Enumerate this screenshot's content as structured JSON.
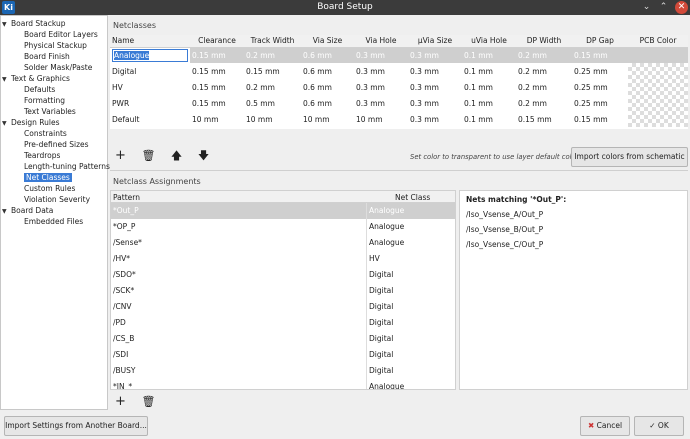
{
  "window": {
    "title": "Board Setup",
    "app_icon": "Ki"
  },
  "sidebar": {
    "items": [
      {
        "label": "Board Stackup",
        "level": 0
      },
      {
        "label": "Board Editor Layers",
        "level": 1
      },
      {
        "label": "Physical Stackup",
        "level": 1
      },
      {
        "label": "Board Finish",
        "level": 1
      },
      {
        "label": "Solder Mask/Paste",
        "level": 1
      },
      {
        "label": "Text & Graphics",
        "level": 0
      },
      {
        "label": "Defaults",
        "level": 1
      },
      {
        "label": "Formatting",
        "level": 1
      },
      {
        "label": "Text Variables",
        "level": 1
      },
      {
        "label": "Design Rules",
        "level": 0
      },
      {
        "label": "Constraints",
        "level": 1
      },
      {
        "label": "Pre-defined Sizes",
        "level": 1
      },
      {
        "label": "Teardrops",
        "level": 1
      },
      {
        "label": "Length-tuning Patterns",
        "level": 1
      },
      {
        "label": "Net Classes",
        "level": 1,
        "selected": true
      },
      {
        "label": "Custom Rules",
        "level": 1
      },
      {
        "label": "Violation Severity",
        "level": 1
      },
      {
        "label": "Board Data",
        "level": 0
      },
      {
        "label": "Embedded Files",
        "level": 1
      }
    ]
  },
  "netclasses": {
    "section_label": "Netclasses",
    "columns": [
      "Name",
      "Clearance",
      "Track Width",
      "Via Size",
      "Via Hole",
      "µVia Size",
      "uVia Hole",
      "DP Width",
      "DP Gap",
      "PCB Color"
    ],
    "rows": [
      [
        "Analogue",
        "0.15 mm",
        "0.2 mm",
        "0.6 mm",
        "0.3 mm",
        "0.3 mm",
        "0.1 mm",
        "0.2 mm",
        "0.15 mm"
      ],
      [
        "Digital",
        "0.15 mm",
        "0.15 mm",
        "0.6 mm",
        "0.3 mm",
        "0.3 mm",
        "0.1 mm",
        "0.2 mm",
        "0.25 mm"
      ],
      [
        "HV",
        "0.15 mm",
        "0.2 mm",
        "0.6 mm",
        "0.3 mm",
        "0.3 mm",
        "0.1 mm",
        "0.2 mm",
        "0.25 mm"
      ],
      [
        "PWR",
        "0.15 mm",
        "0.5 mm",
        "0.6 mm",
        "0.3 mm",
        "0.3 mm",
        "0.1 mm",
        "0.2 mm",
        "0.25 mm"
      ],
      [
        "Default",
        "10 mm",
        "10 mm",
        "10 mm",
        "10 mm",
        "0.3 mm",
        "0.1 mm",
        "0.15 mm",
        "0.15 mm"
      ]
    ],
    "hint": "Set color to transparent to use layer default color.",
    "import_colors_label": "Import colors from schematic",
    "icons": [
      "plus-icon",
      "trash-icon",
      "arrow-up-icon",
      "arrow-down-icon"
    ]
  },
  "assignments": {
    "section_label": "Netclass Assignments",
    "columns": [
      "Pattern",
      "Net Class"
    ],
    "rows": [
      [
        "*Out_P",
        "Analogue"
      ],
      [
        "*OP_P",
        "Analogue"
      ],
      [
        "/Sense*",
        "Analogue"
      ],
      [
        "/HV*",
        "HV"
      ],
      [
        "/SDO*",
        "Digital"
      ],
      [
        "/SCK*",
        "Digital"
      ],
      [
        "/CNV",
        "Digital"
      ],
      [
        "/PD",
        "Digital"
      ],
      [
        "/CS_B",
        "Digital"
      ],
      [
        "/SDI",
        "Digital"
      ],
      [
        "/BUSY",
        "Digital"
      ],
      [
        "*IN_*",
        "Analogue"
      ]
    ],
    "icons": [
      "plus-icon",
      "trash-icon"
    ]
  },
  "nets": {
    "heading": "Nets matching '*Out_P':",
    "items": [
      "/Iso_Vsense_A/Out_P",
      "/Iso_Vsense_B/Out_P",
      "/Iso_Vsense_C/Out_P"
    ]
  },
  "footer": {
    "import_settings_label": "Import Settings from Another Board...",
    "cancel_label": "Cancel",
    "ok_label": "OK"
  },
  "colors": {
    "accent": "#3a7bd5",
    "titlebar": "#3b3b3b",
    "close": "#d24a3a"
  }
}
